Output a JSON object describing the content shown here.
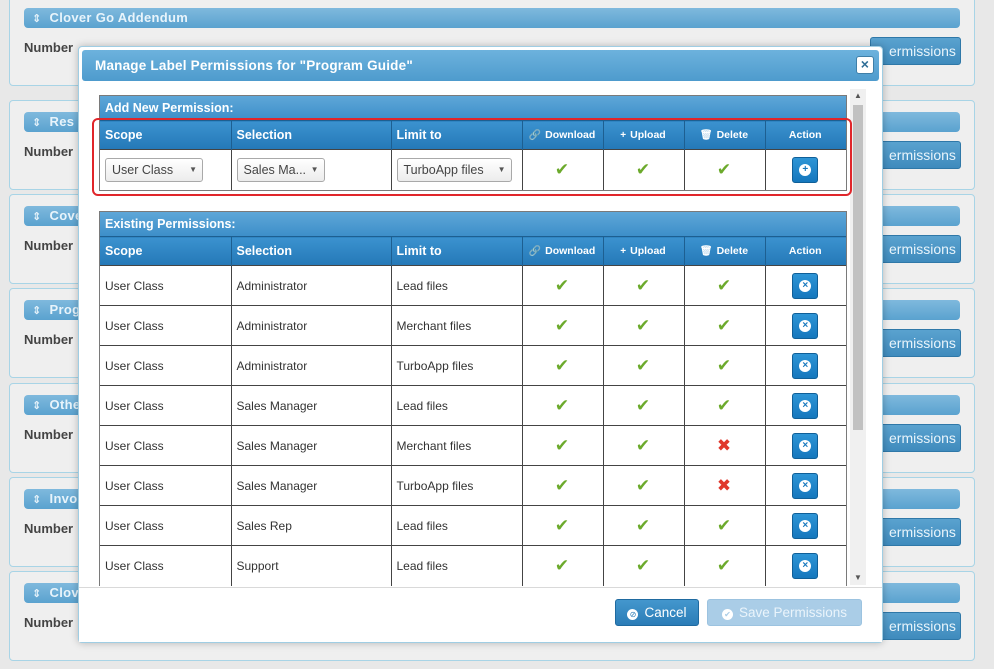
{
  "background": {
    "panels": [
      {
        "title": "Clover Go Addendum",
        "number_label": "Number",
        "button": "ermissions"
      },
      {
        "title": "Res",
        "number_label": "Number",
        "button": "ermissions"
      },
      {
        "title": "Cove",
        "number_label": "Number",
        "button": "ermissions"
      },
      {
        "title": "Prog",
        "number_label": "Number",
        "button": "ermissions"
      },
      {
        "title": "Othe",
        "number_label": "Number",
        "button": "ermissions"
      },
      {
        "title": "Invo",
        "number_label": "Number",
        "button": "ermissions"
      },
      {
        "title": "Clov",
        "number_label": "Number",
        "button": "ermissions"
      }
    ]
  },
  "modal": {
    "title": "Manage Label Permissions for \"Program Guide\"",
    "close": "×",
    "columns": {
      "scope": "Scope",
      "selection": "Selection",
      "limit": "Limit to",
      "download": "Download",
      "upload": "Upload",
      "delete": "Delete",
      "action": "Action"
    },
    "add_new": {
      "title": "Add New Permission:",
      "scope_value": "User Class",
      "selection_value": "Sales Ma...",
      "limit_value": "TurboApp files",
      "download": true,
      "upload": true,
      "delete": true
    },
    "existing": {
      "title": "Existing Permissions:",
      "rows": [
        {
          "scope": "User Class",
          "selection": "Administrator",
          "limit": "Lead files",
          "download": true,
          "upload": true,
          "delete": true
        },
        {
          "scope": "User Class",
          "selection": "Administrator",
          "limit": "Merchant files",
          "download": true,
          "upload": true,
          "delete": true
        },
        {
          "scope": "User Class",
          "selection": "Administrator",
          "limit": "TurboApp files",
          "download": true,
          "upload": true,
          "delete": true
        },
        {
          "scope": "User Class",
          "selection": "Sales Manager",
          "limit": "Lead files",
          "download": true,
          "upload": true,
          "delete": true
        },
        {
          "scope": "User Class",
          "selection": "Sales Manager",
          "limit": "Merchant files",
          "download": true,
          "upload": true,
          "delete": false
        },
        {
          "scope": "User Class",
          "selection": "Sales Manager",
          "limit": "TurboApp files",
          "download": true,
          "upload": true,
          "delete": false
        },
        {
          "scope": "User Class",
          "selection": "Sales Rep",
          "limit": "Lead files",
          "download": true,
          "upload": true,
          "delete": true
        },
        {
          "scope": "User Class",
          "selection": "Support",
          "limit": "Lead files",
          "download": true,
          "upload": true,
          "delete": true
        }
      ]
    },
    "footer": {
      "cancel": "Cancel",
      "save": "Save Permissions"
    }
  },
  "colors": {
    "header_blue": "#2478b7",
    "check_green": "#6caa2c",
    "cross_red": "#e0382c",
    "highlight": "#e0262b"
  }
}
